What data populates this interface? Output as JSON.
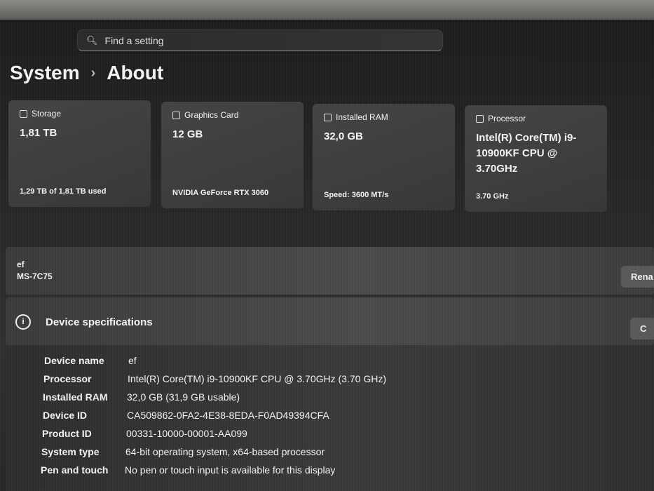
{
  "search": {
    "placeholder": "Find a setting"
  },
  "breadcrumb": {
    "parent": "System",
    "current": "About"
  },
  "cards": [
    {
      "label": "Storage",
      "icon": "storage-icon",
      "value": "1,81 TB",
      "sub": "1,29 TB of 1,81 TB used"
    },
    {
      "label": "Graphics Card",
      "icon": "graphics-card-icon",
      "value": "12 GB",
      "sub": "NVIDIA GeForce RTX 3060"
    },
    {
      "label": "Installed RAM",
      "icon": "ram-icon",
      "value": "32,0 GB",
      "sub": "Speed: 3600 MT/s"
    },
    {
      "label": "Processor",
      "icon": "processor-icon",
      "value": "Intel(R) Core(TM) i9-10900KF CPU @ 3.70GHz",
      "sub": "3.70 GHz"
    }
  ],
  "device": {
    "name": "ef",
    "model": "MS-7C75",
    "rename_label": "Rena"
  },
  "specs": {
    "title": "Device specifications",
    "copy_label": "C",
    "rows": [
      {
        "k": "Device name",
        "v": "ef"
      },
      {
        "k": "Processor",
        "v": "Intel(R) Core(TM) i9-10900KF CPU @ 3.70GHz (3.70 GHz)"
      },
      {
        "k": "Installed RAM",
        "v": "32,0 GB (31,9 GB usable)"
      },
      {
        "k": "Device ID",
        "v": "CA509862-0FA2-4E38-8EDA-F0AD49394CFA"
      },
      {
        "k": "Product ID",
        "v": "00331-10000-00001-AA099"
      },
      {
        "k": "System type",
        "v": "64-bit operating system, x64-based processor"
      },
      {
        "k": "Pen and touch",
        "v": "No pen or touch input is available for this display"
      }
    ]
  }
}
